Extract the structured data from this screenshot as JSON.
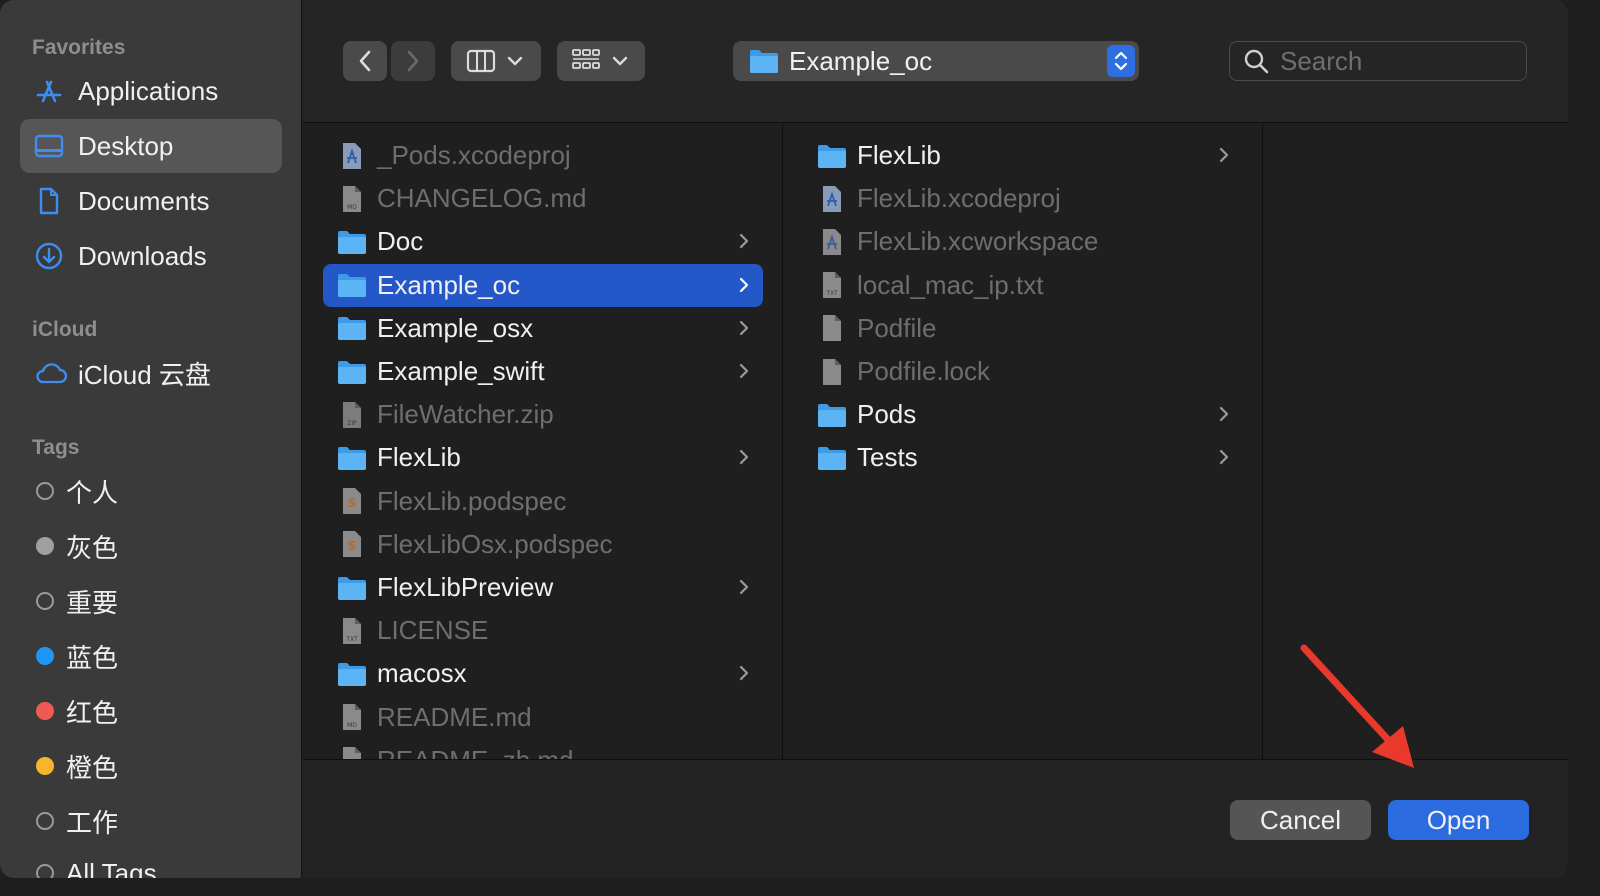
{
  "sidebar": {
    "favorites_heading": "Favorites",
    "favorites": [
      {
        "label": "Applications",
        "icon": "applications-icon"
      },
      {
        "label": "Desktop",
        "icon": "desktop-icon",
        "selected": true
      },
      {
        "label": "Documents",
        "icon": "document-icon"
      },
      {
        "label": "Downloads",
        "icon": "downloads-icon"
      }
    ],
    "icloud_heading": "iCloud",
    "icloud": [
      {
        "label": "iCloud 云盘",
        "icon": "cloud-icon"
      }
    ],
    "tags_heading": "Tags",
    "tags": [
      {
        "label": "个人",
        "color": "none"
      },
      {
        "label": "灰色",
        "color": "#a0a0a0"
      },
      {
        "label": "重要",
        "color": "none"
      },
      {
        "label": "蓝色",
        "color": "#1e96f5"
      },
      {
        "label": "红色",
        "color": "#ef5a55"
      },
      {
        "label": "橙色",
        "color": "#f7b52c"
      },
      {
        "label": "工作",
        "color": "none"
      },
      {
        "label": "All Tags",
        "color": "none"
      }
    ]
  },
  "toolbar": {
    "back_icon": "chevron-left-icon",
    "forward_icon": "chevron-right-icon",
    "view_columns_icon": "columns-view-icon",
    "group_icon": "grid-group-icon",
    "location": "Example_oc",
    "search_placeholder": "Search"
  },
  "column1": [
    {
      "name": "_Pods.xcodeproj",
      "type": "xcodeproj",
      "dim": true
    },
    {
      "name": "CHANGELOG.md",
      "type": "md",
      "dim": true
    },
    {
      "name": "Doc",
      "type": "folder",
      "dim": false
    },
    {
      "name": "Example_oc",
      "type": "folder",
      "dim": false,
      "selected": true
    },
    {
      "name": "Example_osx",
      "type": "folder",
      "dim": false
    },
    {
      "name": "Example_swift",
      "type": "folder",
      "dim": false
    },
    {
      "name": "FileWatcher.zip",
      "type": "zip",
      "dim": true
    },
    {
      "name": "FlexLib",
      "type": "folder",
      "dim": false
    },
    {
      "name": "FlexLib.podspec",
      "type": "podspec",
      "dim": true
    },
    {
      "name": "FlexLibOsx.podspec",
      "type": "podspec",
      "dim": true
    },
    {
      "name": "FlexLibPreview",
      "type": "folder",
      "dim": false
    },
    {
      "name": "LICENSE",
      "type": "txt",
      "dim": true
    },
    {
      "name": "macosx",
      "type": "folder",
      "dim": false
    },
    {
      "name": "README.md",
      "type": "md",
      "dim": true
    },
    {
      "name": "README_zh.md",
      "type": "md",
      "dim": true
    }
  ],
  "column2": [
    {
      "name": "FlexLib",
      "type": "folder",
      "dim": false
    },
    {
      "name": "FlexLib.xcodeproj",
      "type": "xcodeproj",
      "dim": true
    },
    {
      "name": "FlexLib.xcworkspace",
      "type": "xcworkspace",
      "dim": true
    },
    {
      "name": "local_mac_ip.txt",
      "type": "txt",
      "dim": true
    },
    {
      "name": "Podfile",
      "type": "file",
      "dim": true
    },
    {
      "name": "Podfile.lock",
      "type": "file",
      "dim": true
    },
    {
      "name": "Pods",
      "type": "folder",
      "dim": false
    },
    {
      "name": "Tests",
      "type": "folder",
      "dim": false
    }
  ],
  "buttons": {
    "cancel": "Cancel",
    "open": "Open"
  },
  "colors": {
    "accent": "#2b6be0",
    "selection": "#2458c9",
    "folder": "#4aa8f0",
    "annotation_arrow": "#e8392c"
  }
}
